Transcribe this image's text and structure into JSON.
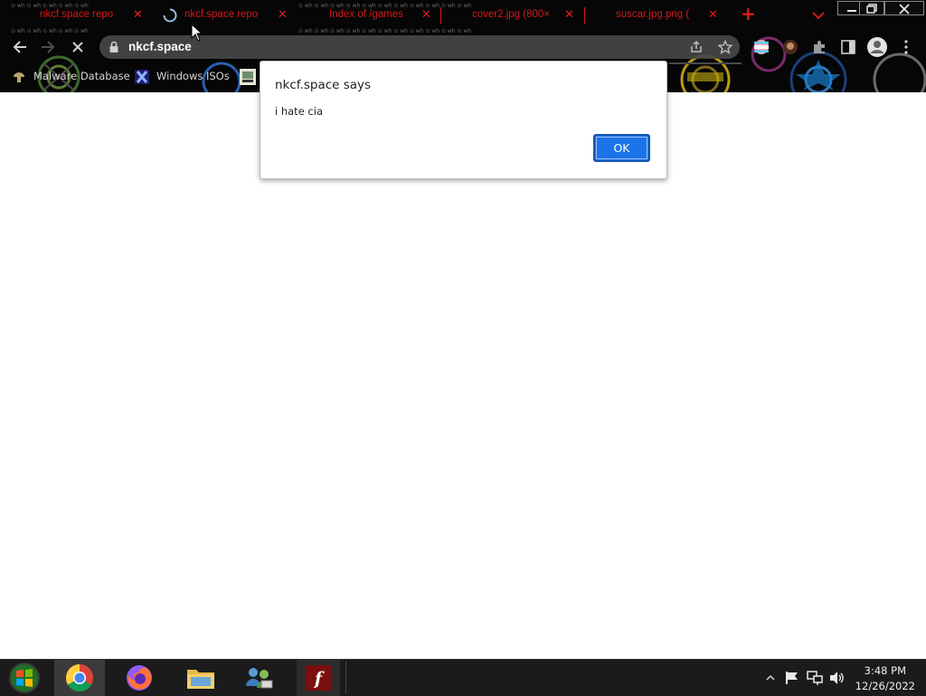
{
  "browser": {
    "tabs": [
      {
        "title": "nkcf.space repo",
        "active": false,
        "loading": false
      },
      {
        "title": "nkcf.space repo",
        "active": true,
        "loading": true
      },
      {
        "title": "Index of /games",
        "active": false,
        "loading": false
      },
      {
        "title": "cover2.jpg (800×",
        "active": false,
        "loading": false
      },
      {
        "title": "suscar.jpg.png (",
        "active": false,
        "loading": false
      }
    ],
    "tab_close_glyph": "✕",
    "new_tab_glyph": "+",
    "url": "nkcf.space",
    "bookmarks": [
      {
        "label": "Malware Database",
        "icon": "mushroom-icon"
      },
      {
        "label": "Windows ISOs",
        "icon": "x-logo-icon"
      },
      {
        "label": "",
        "icon": "image-thumbnail-icon"
      }
    ],
    "accent_color": "#d11a1a"
  },
  "dialog": {
    "title": "nkcf.space says",
    "message": "i hate cia",
    "ok_label": "OK",
    "button_color": "#1a73e8"
  },
  "taskbar": {
    "apps": [
      {
        "name": "start",
        "icon": "windows-start-icon"
      },
      {
        "name": "chrome",
        "icon": "chrome-icon",
        "active": true
      },
      {
        "name": "firefox",
        "icon": "firefox-icon"
      },
      {
        "name": "file-explorer",
        "icon": "folder-icon"
      },
      {
        "name": "network",
        "icon": "network-users-icon"
      },
      {
        "name": "flash",
        "icon": "flash-player-icon"
      }
    ],
    "tray_icons": [
      "show-hidden-icon",
      "action-center-flag-icon",
      "network-icon",
      "volume-icon"
    ],
    "time": "3:48 PM",
    "date": "12/26/2022"
  }
}
